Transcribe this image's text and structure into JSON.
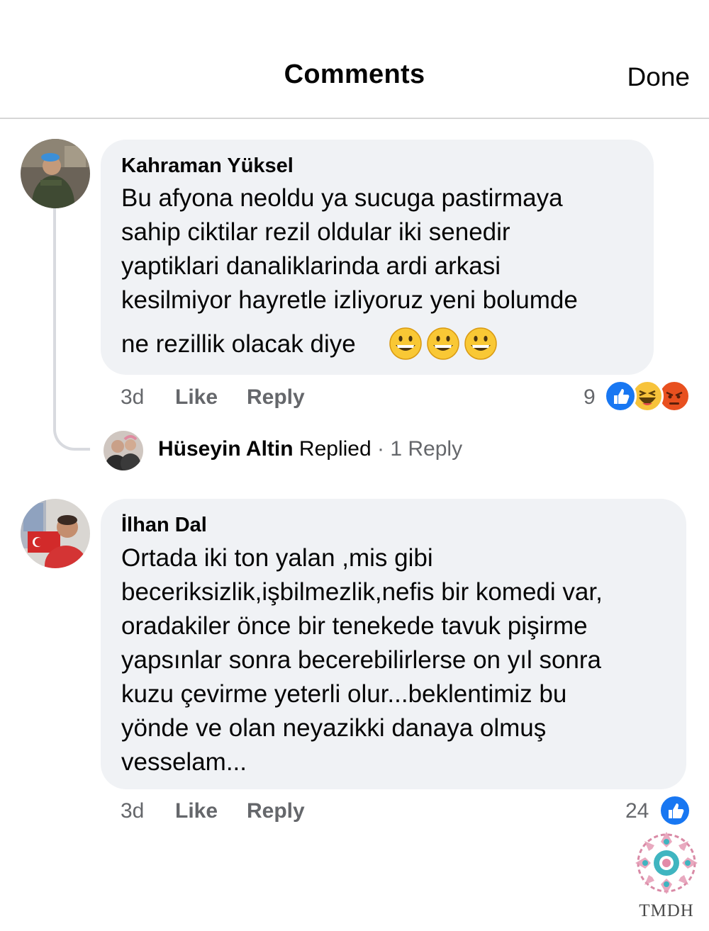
{
  "header": {
    "title": "Comments",
    "done_label": "Done"
  },
  "comments": [
    {
      "author": "Kahraman Yüksel",
      "lines": [
        "Bu afyona neoldu ya sucuga pastirmaya",
        "sahip ciktilar rezil oldular iki senedir",
        "yaptiklari danaliklarinda ardi arkasi",
        "kesilmiyor hayretle izliyoruz yeni bolumde",
        "ne rezillik olacak diye"
      ],
      "emoji": "😀😀😀",
      "time": "3d",
      "like_label": "Like",
      "reply_label": "Reply",
      "reaction_count": "9",
      "reactions": [
        "like-reaction-icon",
        "haha-reaction-icon",
        "angry-reaction-icon"
      ],
      "reply_summary": {
        "author": "Hüseyin Altin",
        "action": "Replied",
        "separator": "·",
        "count": "1 Reply"
      }
    },
    {
      "author": "İlhan Dal",
      "lines": [
        "Ortada iki ton yalan ,mis gibi",
        "beceriksizlik,işbilmezlik,nefis bir komedi var,",
        "oradakiler önce bir tenekede tavuk pişirme",
        "yapsınlar sonra becerebilirlerse on yıl sonra",
        "kuzu çevirme yeterli olur...beklentimiz bu",
        "yönde ve olan neyazikki danaya olmuş",
        "vesselam..."
      ],
      "time": "3d",
      "like_label": "Like",
      "reply_label": "Reply",
      "reaction_count": "24",
      "reactions": [
        "like-reaction-icon"
      ]
    }
  ],
  "watermark": {
    "text": "TMDH"
  },
  "colors": {
    "bubble": "#f0f2f5",
    "meta": "#65676b",
    "like_blue": "#1877f2",
    "haha_yellow": "#f7c33b",
    "angry_orange": "#e8501f"
  }
}
